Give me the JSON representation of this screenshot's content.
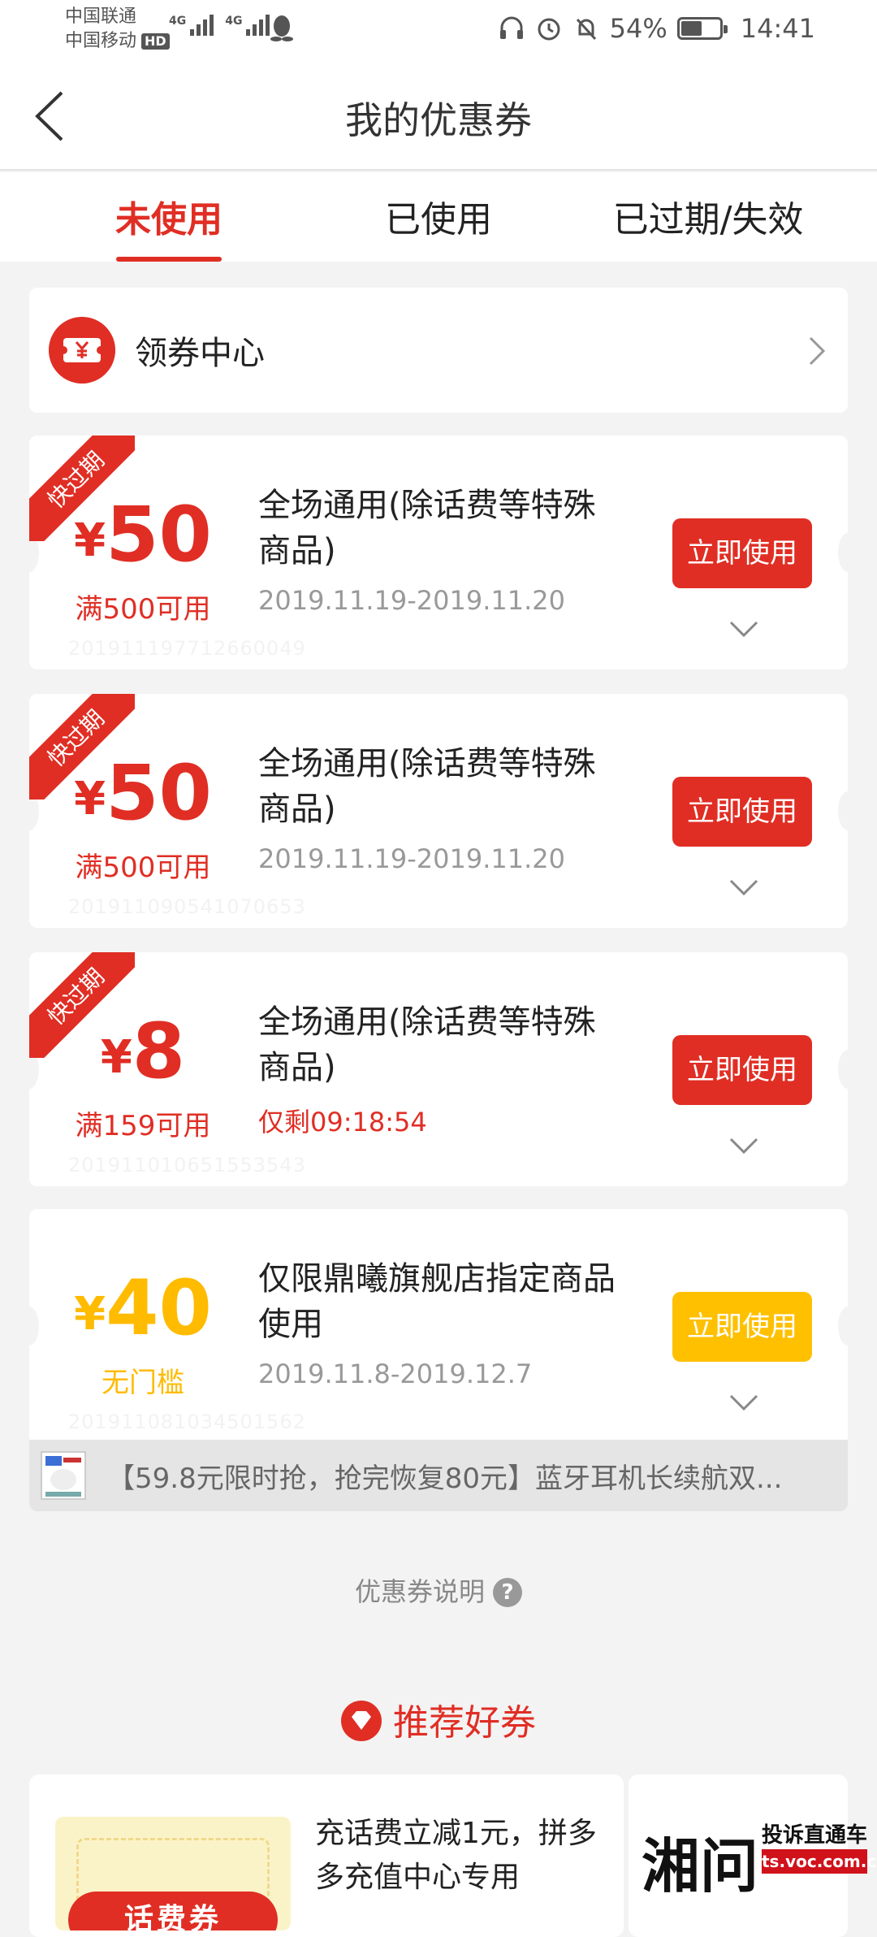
{
  "status_bar": {
    "carrier1": "中国联通",
    "carrier2": "中国移动",
    "hd_badge": "HD",
    "net1": "4G",
    "net2": "4G",
    "battery_percent": "54%",
    "battery_level": 0.54,
    "time": "14:41"
  },
  "header": {
    "title": "我的优惠券"
  },
  "tabs": [
    {
      "label": "未使用",
      "active": true
    },
    {
      "label": "已使用",
      "active": false
    },
    {
      "label": "已过期/失效",
      "active": false
    }
  ],
  "coupon_center": {
    "icon_glyph": "¥",
    "label": "领券中心"
  },
  "coupons": [
    {
      "ribbon": "快过期",
      "currency": "¥",
      "amount": "50",
      "condition": "满500可用",
      "title": "全场通用(除话费等特殊商品)",
      "validity": "2019.11.19-2019.11.20",
      "button": "立即使用",
      "faint_code": "201911197712660049"
    },
    {
      "ribbon": "快过期",
      "currency": "¥",
      "amount": "50",
      "condition": "满500可用",
      "title": "全场通用(除话费等特殊商品)",
      "validity": "2019.11.19-2019.11.20",
      "button": "立即使用",
      "faint_code": "201911090541070653"
    },
    {
      "ribbon": "快过期",
      "currency": "¥",
      "amount": "8",
      "condition": "满159可用",
      "title": "全场通用(除话费等特殊商品)",
      "validity": "仅剩09:18:54",
      "button": "立即使用",
      "faint_code": "201911010651553543"
    },
    {
      "ribbon": "",
      "currency": "¥",
      "amount": "40",
      "condition": "无门槛",
      "title": "仅限鼎曦旗舰店指定商品使用",
      "validity": "2019.11.8-2019.12.7",
      "button": "立即使用",
      "faint_code": "201911081034501562"
    }
  ],
  "ad_strip": {
    "text": "【59.8元限时抢，抢完恢复80元】蓝牙耳机长续航双..."
  },
  "explain": {
    "label": "优惠券说明",
    "help_icon": "?"
  },
  "recommend": {
    "title": "推荐好券",
    "card": {
      "image_label": "话费券",
      "text": "充话费立减1元，拼多多充值中心专用"
    }
  },
  "watermark": {
    "logo": "湘问",
    "tagline": "投诉直通车",
    "url": "ts.voc.com.cn"
  },
  "colors": {
    "accent": "#e02e24",
    "yellow": "#ffc000",
    "background": "#f3f3f3"
  }
}
